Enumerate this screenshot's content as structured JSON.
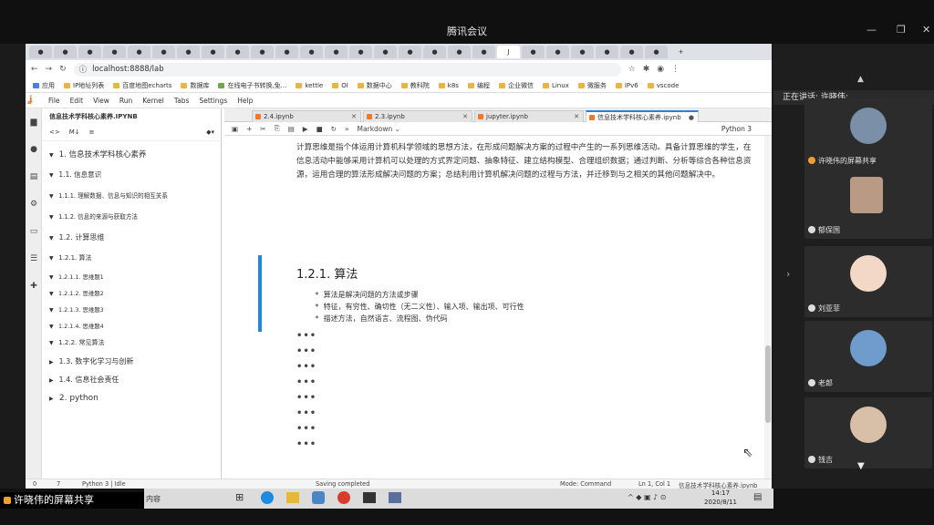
{
  "meeting": {
    "app_title": "腾讯会议",
    "speaking": "正在讲话: 许晓伟;",
    "sharing_label": "许晓伟的屏幕共享",
    "bottom_hint": "内容",
    "participants": [
      {
        "name": "许晓伟的屏幕共享",
        "kind": "share"
      },
      {
        "name": "郁保国",
        "kind": "camera"
      },
      {
        "name": "刘亚菲",
        "kind": "avatar"
      },
      {
        "name": "老郎",
        "kind": "avatar"
      },
      {
        "name": "钱吉",
        "kind": "avatar"
      }
    ],
    "clock": {
      "time": "14:17",
      "date": "2020/8/11"
    }
  },
  "browser": {
    "url": "localhost:8888/lab",
    "bookmarks": [
      "应用",
      "IP地址列表",
      "百度地图echarts",
      "数据库",
      "在线电子书转换,免...",
      "kettle",
      "OI",
      "数据中心",
      "教科院",
      "k8s",
      "编程",
      "企业微信",
      "Linux",
      "微服务",
      "IPv6",
      "vscode"
    ]
  },
  "jupyter": {
    "menu": [
      "File",
      "Edit",
      "View",
      "Run",
      "Kernel",
      "Tabs",
      "Settings",
      "Help"
    ],
    "toc_title": "信息技术学科核心素养.IPYNB",
    "toc_tools": [
      "<>",
      "M↓",
      "≡"
    ],
    "toc": [
      {
        "label": "1. 信息技术学科核心素养",
        "level": 1,
        "open": true
      },
      {
        "label": "1.1. 信息意识",
        "level": 2,
        "open": true
      },
      {
        "label": "1.1.1. 理解数据、信息与知识的相互关系",
        "level": 3,
        "open": true
      },
      {
        "label": "1.1.2. 信息的来源与获取方法",
        "level": 3,
        "open": true
      },
      {
        "label": "1.2. 计算思维",
        "level": 2,
        "open": true
      },
      {
        "label": "1.2.1. 算法",
        "level": 3,
        "open": true
      },
      {
        "label": "1.2.1.1. 思维题1",
        "level": 4,
        "open": true
      },
      {
        "label": "1.2.1.2. 思维题2",
        "level": 4,
        "open": true
      },
      {
        "label": "1.2.1.3. 思维题3",
        "level": 4,
        "open": true
      },
      {
        "label": "1.2.1.4. 思维题4",
        "level": 4,
        "open": true
      },
      {
        "label": "1.2.2. 常见算法",
        "level": 3,
        "open": true
      },
      {
        "label": "1.3. 数字化学习与创新",
        "level": 2,
        "open": false
      },
      {
        "label": "1.4. 信息社会责任",
        "level": 2,
        "open": false
      },
      {
        "label": "2. python",
        "level": 1,
        "open": false
      }
    ],
    "tabs": [
      "2.4.ipynb",
      "2.3.ipynb",
      "jupyter.ipynb",
      "信息技术学科核心素养.ipynb"
    ],
    "cell_type": "Markdown",
    "kernel": "Python 3",
    "paragraph": "计算思维是指个体运用计算机科学领域的思想方法，在形成问题解决方案的过程中产生的一系列思维活动。具备计算思维的学生，在信息活动中能够采用计算机可以处理的方式界定问题、抽象特征、建立结构模型、合理组织数据；通过判断、分析等综合各种信息资源，运用合理的算法形成解决问题的方案；总结利用计算机解决问题的过程与方法，并迁移到与之相关的其他问题解决中。",
    "section_heading": "1.2.1. 算法",
    "bullets": [
      "* 算法是解决问题的方法或步骤",
      "* 特征，有穷性、确切性（无二义性）、输入项、输出项、可行性",
      "* 描述方法，自然语言、流程图、伪代码"
    ],
    "collapsed_marker": "•••",
    "status": {
      "left": "0",
      "count": "7",
      "kernel_state": "Python 3 | Idle",
      "saving": "Saving completed",
      "mode": "Mode: Command",
      "cursor": "Ln 1, Col 1",
      "file": "信息技术学科核心素养.ipynb"
    }
  }
}
